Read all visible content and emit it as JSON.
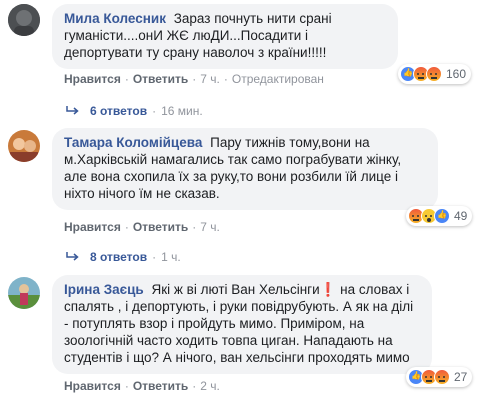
{
  "comments": [
    {
      "author": "Мила Колесник",
      "text": "Зараз почнуть нити срані гуманісти....онИ ЖЄ люДИ...Посадити і депортувати ту срану наволоч з країни!!!!!",
      "actions": {
        "like": "Нравится",
        "reply": "Ответить",
        "time": "7 ч.",
        "edited": "Отредактирован"
      },
      "reactions": {
        "types": [
          "like",
          "angry",
          "angry"
        ],
        "count": "160"
      },
      "replies": {
        "count": "6 ответов",
        "time": "16 мин."
      }
    },
    {
      "author": "Тамара Коломійцева",
      "text": "Пару тижнів тому,вони на м.Харківській намагались так само пограбувати жінку, але вона схопила їх за руку,то вони розбили їй лице і ніхто нічого їм не сказав.",
      "actions": {
        "like": "Нравится",
        "reply": "Ответить",
        "time": "7 ч."
      },
      "reactions": {
        "types": [
          "angry",
          "wow",
          "like"
        ],
        "count": "49"
      },
      "replies": {
        "count": "8 ответов",
        "time": "1 ч."
      }
    },
    {
      "author": "Ірина Заєць",
      "text": "Які ж ві лютi Ван Хельсінги❗ на словах і спалять , і депортують, і руки повідрубують. А як на ділі - потуплять взор і пройдуть мимо. Приміром, на зоологічній часто ходить товпа циган. Нападають на студентів і що? А нічого, ван хельсінги проходять мимо",
      "actions": {
        "like": "Нравится",
        "reply": "Ответить",
        "time": "2 ч."
      },
      "reactions": {
        "types": [
          "like",
          "angry",
          "angry"
        ],
        "count": "27"
      }
    }
  ]
}
